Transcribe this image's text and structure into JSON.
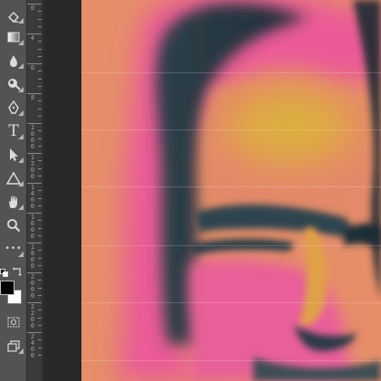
{
  "tools": [
    {
      "name": "eraser-tool",
      "icon": "eraser-icon",
      "glyph": "",
      "selected": false
    },
    {
      "name": "gradient-tool",
      "icon": "gradient-icon",
      "glyph": "",
      "selected": false
    },
    {
      "name": "blur-tool",
      "icon": "blur-drop-icon",
      "glyph": "",
      "selected": false
    },
    {
      "name": "dodge-tool",
      "icon": "dodge-icon",
      "glyph": "",
      "selected": false
    },
    {
      "name": "pen-tool",
      "icon": "pen-icon",
      "glyph": "",
      "selected": false
    },
    {
      "name": "type-tool",
      "icon": "type-icon",
      "glyph": "T",
      "selected": false
    },
    {
      "name": "path-selection-tool",
      "icon": "arrow-pointer-icon",
      "glyph": "",
      "selected": false
    },
    {
      "name": "shape-tool",
      "icon": "triangle-icon",
      "glyph": "",
      "selected": false
    },
    {
      "name": "hand-tool",
      "icon": "hand-icon",
      "glyph": "",
      "selected": false
    },
    {
      "name": "zoom-tool",
      "icon": "magnifier-icon",
      "glyph": "",
      "selected": false
    },
    {
      "name": "edit-toolbar-button",
      "icon": "more-icon",
      "glyph": "•••",
      "selected": false
    }
  ],
  "swatches": {
    "foreground": "#000000",
    "background": "#ffffff"
  },
  "ruler": {
    "labels": [
      "0",
      "4",
      "6",
      "8",
      "1000",
      "1200",
      "1400",
      "1600",
      "1800",
      "2000",
      "2200",
      "2400"
    ]
  },
  "canvas": {
    "description_colors": {
      "background": "#e98f68",
      "shadow": "#2c4550",
      "highlight": "#d7b23a",
      "magenta": "#ea5c9e"
    }
  }
}
